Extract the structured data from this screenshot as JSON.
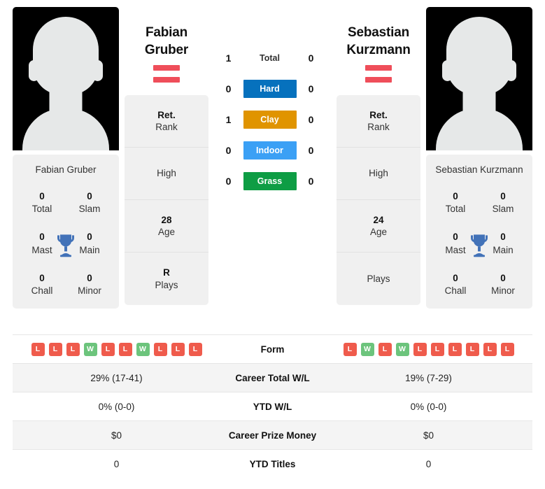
{
  "players": {
    "left": {
      "name_line1": "Fabian",
      "name_line2": "Gruber",
      "full_name": "Fabian Gruber",
      "country_flag": "austria-flag",
      "titles": [
        {
          "value": "0",
          "label": "Total"
        },
        {
          "value": "0",
          "label": "Slam"
        },
        {
          "value": "0",
          "label": "Mast"
        },
        {
          "value": "0",
          "label": "Main"
        },
        {
          "value": "0",
          "label": "Chall"
        },
        {
          "value": "0",
          "label": "Minor"
        }
      ],
      "info": [
        {
          "value": "Ret.",
          "label": "Rank"
        },
        {
          "value": "",
          "label": "High"
        },
        {
          "value": "28",
          "label": "Age"
        },
        {
          "value": "R",
          "label": "Plays"
        }
      ],
      "form": [
        "L",
        "L",
        "L",
        "W",
        "L",
        "L",
        "W",
        "L",
        "L",
        "L"
      ]
    },
    "right": {
      "name_line1": "Sebastian",
      "name_line2": "Kurzmann",
      "full_name": "Sebastian Kurzmann",
      "country_flag": "austria-flag",
      "titles": [
        {
          "value": "0",
          "label": "Total"
        },
        {
          "value": "0",
          "label": "Slam"
        },
        {
          "value": "0",
          "label": "Mast"
        },
        {
          "value": "0",
          "label": "Main"
        },
        {
          "value": "0",
          "label": "Chall"
        },
        {
          "value": "0",
          "label": "Minor"
        }
      ],
      "info": [
        {
          "value": "Ret.",
          "label": "Rank"
        },
        {
          "value": "",
          "label": "High"
        },
        {
          "value": "24",
          "label": "Age"
        },
        {
          "value": "",
          "label": "Plays"
        }
      ],
      "form": [
        "L",
        "W",
        "L",
        "W",
        "L",
        "L",
        "L",
        "L",
        "L",
        "L"
      ]
    }
  },
  "head_to_head": [
    {
      "label": "Total",
      "left": "1",
      "right": "0",
      "style": "plain",
      "color": ""
    },
    {
      "label": "Hard",
      "left": "0",
      "right": "0",
      "style": "surface",
      "color": "#0671bd"
    },
    {
      "label": "Clay",
      "left": "1",
      "right": "0",
      "style": "surface",
      "color": "#e09400"
    },
    {
      "label": "Indoor",
      "left": "0",
      "right": "0",
      "style": "surface",
      "color": "#3ba0f5"
    },
    {
      "label": "Grass",
      "left": "0",
      "right": "0",
      "style": "surface",
      "color": "#0e9d44"
    }
  ],
  "comparison_rows": [
    {
      "label": "Form",
      "left": "",
      "right": "",
      "type": "form"
    },
    {
      "label": "Career Total W/L",
      "left": "29% (17-41)",
      "right": "19% (7-29)",
      "type": "text"
    },
    {
      "label": "YTD W/L",
      "left": "0% (0-0)",
      "right": "0% (0-0)",
      "type": "text"
    },
    {
      "label": "Career Prize Money",
      "left": "$0",
      "right": "$0",
      "type": "text"
    },
    {
      "label": "YTD Titles",
      "left": "0",
      "right": "0",
      "type": "text"
    }
  ],
  "colors": {
    "win": "#6cc47c",
    "loss": "#ef5b4c",
    "flag_red": "#ef4e5a",
    "trophy": "#4272b8",
    "card_bg": "#f0f0f0",
    "row_shade": "#f4f4f4"
  }
}
